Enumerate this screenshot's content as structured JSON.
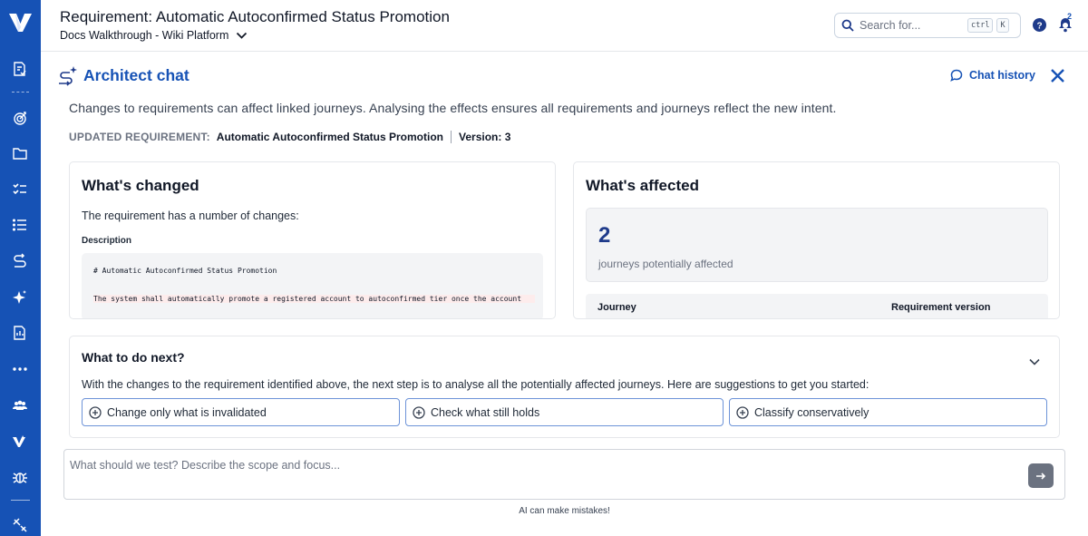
{
  "header": {
    "title": "Requirement: Automatic Autoconfirmed Status Promotion",
    "breadcrumb": "Docs Walkthrough - Wiki Platform",
    "search": {
      "placeholder": "Search for...",
      "shortcut_ctrl": "ctrl",
      "shortcut_key": "K"
    },
    "notification_count": "2"
  },
  "sidebar": {
    "items": [
      {
        "icon": "requirements-icon"
      },
      {
        "icon": "target-icon"
      },
      {
        "icon": "folder-icon"
      },
      {
        "icon": "checklist-icon"
      },
      {
        "icon": "list-icon"
      },
      {
        "icon": "journey-icon"
      },
      {
        "icon": "sparkle-icon"
      },
      {
        "icon": "report-icon"
      },
      {
        "icon": "more-icon"
      },
      {
        "icon": "team-icon"
      },
      {
        "icon": "brand-icon"
      },
      {
        "icon": "bug-icon"
      },
      {
        "icon": "tools-icon"
      }
    ]
  },
  "chat": {
    "title": "Architect chat",
    "history_label": "Chat history",
    "intro": "Changes to requirements can affect linked journeys. Analysing the effects ensures all requirements and journeys reflect the new intent.",
    "updated_requirement": {
      "key_label": "UPDATED REQUIREMENT:",
      "name": "Automatic Autoconfirmed Status Promotion",
      "version": "Version: 3"
    }
  },
  "changed": {
    "title": "What's changed",
    "lead": "The requirement has a number of changes:",
    "description_label": "Description",
    "code_lines": [
      "# Automatic Autoconfirmed Status Promotion",
      "The system shall automatically promote a registered account to autoconfirmed tier once the account"
    ]
  },
  "affected": {
    "title": "What's affected",
    "count": "2",
    "count_label": "journeys potentially affected",
    "columns": [
      "Journey",
      "Requirement version"
    ]
  },
  "next": {
    "title": "What to do next?",
    "subtitle": "With the changes to the requirement identified above, the next step is to analyse all the potentially affected journeys. Here are suggestions to get you started:",
    "suggestions": [
      "Change only what is invalidated",
      "Check what still holds",
      "Classify conservatively"
    ]
  },
  "composer": {
    "placeholder": "What should we test? Describe the scope and focus...",
    "disclaimer": "AI can make mistakes!"
  },
  "colors": {
    "brand": "#1652b5",
    "accent_dark": "#1e3a8a",
    "send_button": "#6b7280"
  }
}
